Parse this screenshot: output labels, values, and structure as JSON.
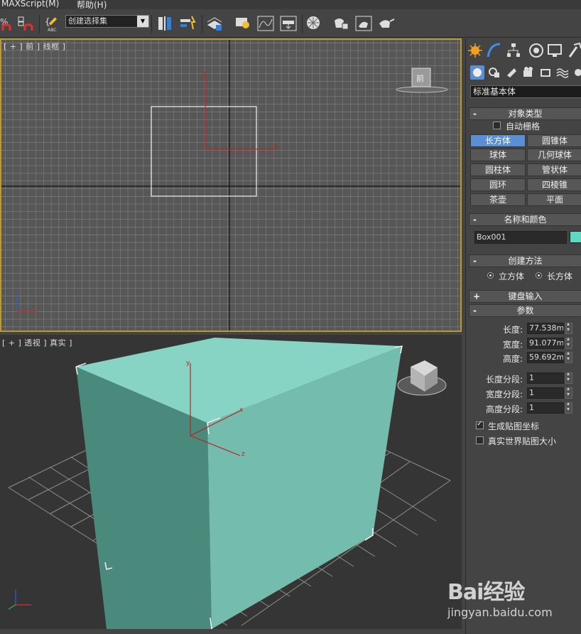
{
  "menu": {
    "maxscript": "MAXScript(M)",
    "help": "帮助(H)"
  },
  "toolbar": {
    "selection_set_placeholder": "创建选择集"
  },
  "viewports": {
    "front": {
      "label": "[ + ] 前 ] 线框 ]",
      "axis_y": "y",
      "axis_x": "x",
      "cube_label": "前"
    },
    "perspective": {
      "label": "[ + ] 透视 ] 真实 ]",
      "axis_y": "y",
      "axis_x": "x",
      "axis_z": "z"
    }
  },
  "panel": {
    "category_dropdown": "标准基本体",
    "object_type": {
      "title": "对象类型",
      "autogrid_label": "自动栅格",
      "buttons": [
        "长方体",
        "圆锥体",
        "球体",
        "几何球体",
        "圆柱体",
        "管状体",
        "圆环",
        "四棱锥",
        "茶壶",
        "平面"
      ],
      "active": "长方体"
    },
    "name_color": {
      "title": "名称和颜色",
      "name": "Box001",
      "color": "#5fd8c2"
    },
    "creation_method": {
      "title": "创建方法",
      "cube": "立方体",
      "box": "长方体",
      "selected": "长方体"
    },
    "keyboard_entry": {
      "title": "键盘输入"
    },
    "parameters": {
      "title": "参数",
      "length_label": "长度:",
      "length_value": "77.538mm",
      "width_label": "宽度:",
      "width_value": "91.077mm",
      "height_label": "高度:",
      "height_value": "59.692mm",
      "length_segs_label": "长度分段:",
      "length_segs_value": "1",
      "width_segs_label": "宽度分段:",
      "width_segs_value": "1",
      "height_segs_label": "高度分段:",
      "height_segs_value": "1",
      "gen_map_coords": "生成贴图坐标",
      "real_world_map_size": "真实世界贴图大小"
    }
  },
  "watermark": {
    "brand": "Bai经验",
    "url": "jingyan.baidu.com"
  }
}
